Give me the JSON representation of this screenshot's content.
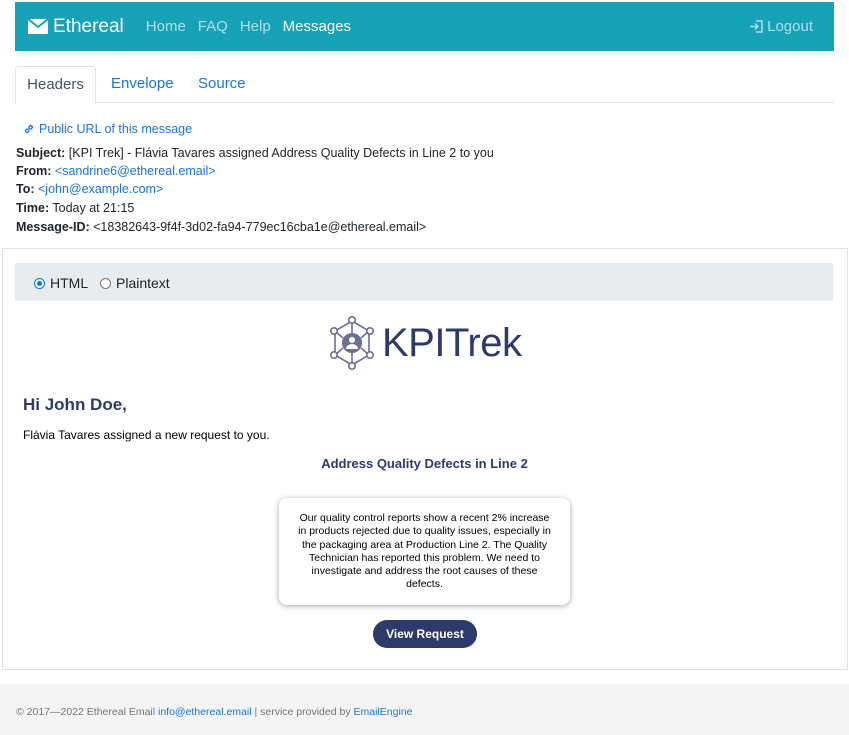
{
  "navbar": {
    "brand": "Ethereal",
    "links": [
      "Home",
      "FAQ",
      "Help",
      "Messages"
    ],
    "active": "Messages",
    "logout": "Logout",
    "colors": {
      "background": "#17a2b8"
    }
  },
  "tabs": [
    {
      "label": "Headers",
      "active": true
    },
    {
      "label": "Envelope",
      "active": false
    },
    {
      "label": "Source",
      "active": false
    }
  ],
  "public_url": "Public URL of this message",
  "headers": {
    "subject_label": "Subject:",
    "subject": "[KPI Trek] - Flávia Tavares assigned Address Quality Defects in Line 2 to you",
    "from_label": "From:",
    "from": "<sandrine6@ethereal.email>",
    "to_label": "To:",
    "to": "<john@example.com>",
    "time_label": "Time:",
    "time": "Today at 21:15",
    "message_id_label": "Message-ID:",
    "message_id": "<18382643-9f4f-3d02-fa94-779ec16cba1e@ethereal.email>"
  },
  "view_toggle": {
    "options": [
      "HTML",
      "Plaintext"
    ],
    "selected": "HTML"
  },
  "email": {
    "logo_text": "KPITrek",
    "greeting": "Hi John Doe,",
    "assigned_text": "Flávia Tavares assigned a new request to you.",
    "request_title": "Address Quality Defects in Line 2",
    "description": "Our quality control reports show a recent 2% increase in products rejected due to quality issues, especially in the packaging area at Production Line 2. The Quality Technician has reported this problem. We need to investigate and address the root causes of these defects.",
    "button": "View Request",
    "colors": {
      "primary": "#2e3a6a"
    }
  },
  "footer": {
    "copyright": "© 2017—2022 Ethereal Email",
    "email": "info@ethereal.email",
    "separator": "| service provided by",
    "provider": "EmailEngine"
  }
}
